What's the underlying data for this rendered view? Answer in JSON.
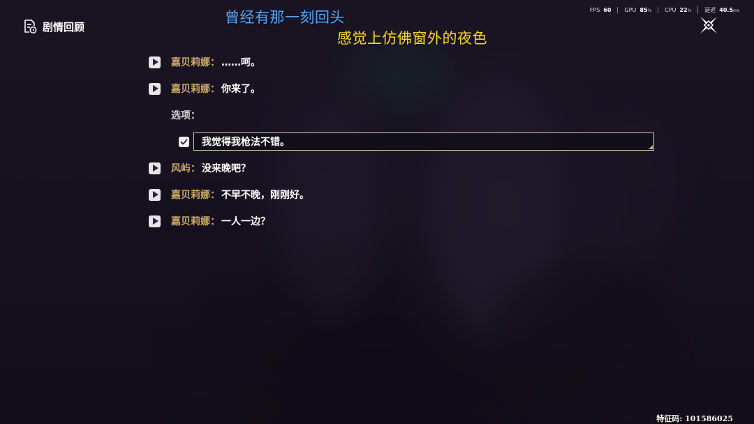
{
  "header": {
    "title": "剧情回顾"
  },
  "lyrics": {
    "line1": "曾经有那一刻回头",
    "line2": "感觉上仿佛窗外的夜色"
  },
  "perf": {
    "fps_label": "FPS",
    "fps_value": "60",
    "gpu_label": "GPU",
    "gpu_value": "85",
    "gpu_unit": "%",
    "cpu_label": "CPU",
    "cpu_value": "22",
    "cpu_unit": "%",
    "latency_label": "延迟",
    "latency_value": "40.5",
    "latency_unit": "ms"
  },
  "dialogue": [
    {
      "speaker": "嘉贝莉娜",
      "colon": "：",
      "text": "……呵。"
    },
    {
      "speaker": "嘉贝莉娜",
      "colon": "：",
      "text": "你来了。"
    }
  ],
  "options": {
    "label": "选项：",
    "selected": "我觉得我枪法不错。"
  },
  "dialogue_after": [
    {
      "speaker": "风屿",
      "colon": "：",
      "text": "没来晚吧？"
    },
    {
      "speaker": "嘉贝莉娜",
      "colon": "：",
      "text": "不早不晚，刚刚好。"
    },
    {
      "speaker": "嘉贝莉娜",
      "colon": "：",
      "text": "一人一边？"
    }
  ],
  "watermark": "特征码: 101586025",
  "colors": {
    "speaker": "#c9a96a",
    "lyric_blue": "#5aa3f0",
    "lyric_yellow": "#f2d23a"
  },
  "icons": {
    "title_icon": "document-history-icon",
    "close": "close-x-icon",
    "play": "play-icon",
    "check": "checkbox-checked-icon"
  }
}
